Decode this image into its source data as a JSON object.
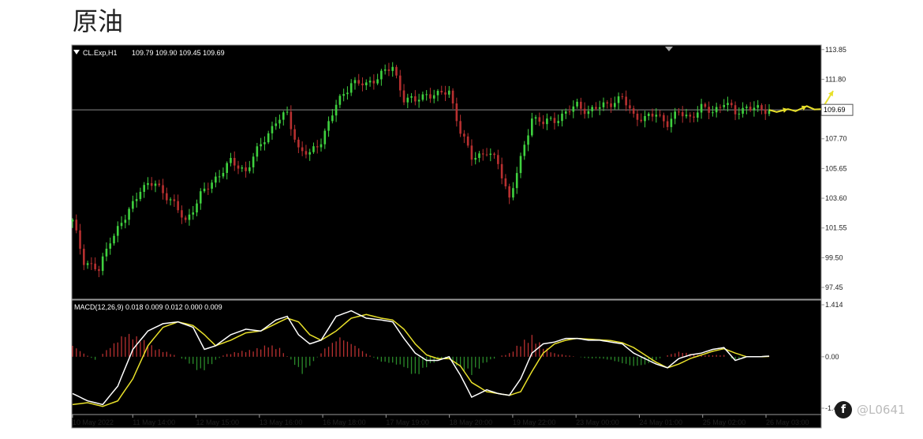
{
  "header": {
    "title": "原油"
  },
  "watermark": {
    "icon": "facebook-icon",
    "text": "@L0641"
  },
  "chart_data": [
    {
      "type": "candlestick",
      "symbol_label": "CL.Exp,H1",
      "ohlc_label": "109.79 109.90 109.45 109.69",
      "current_price_label": "109.69",
      "ylim": [
        96.8,
        114.0
      ],
      "yticks": [
        "113.85",
        "111.80",
        "109.69",
        "107.70",
        "105.65",
        "103.60",
        "101.55",
        "99.50",
        "97.45"
      ],
      "xtick_labels": [
        "10 May 2022",
        "11 May 14:00",
        "12 May 15:00",
        "13 May 16:00",
        "16 May 18:00",
        "17 May 19:00",
        "18 May 20:00",
        "19 May 22:00",
        "23 May 00:00",
        "24 May 01:00",
        "25 May 02:00",
        "26 May 03:00"
      ],
      "up_color": "#3fd13f",
      "down_color": "#b83030",
      "background": "#000000",
      "current_price": 109.69,
      "close_path": [
        {
          "i": 0,
          "v": 102.0
        },
        {
          "i": 3,
          "v": 99.3
        },
        {
          "i": 7,
          "v": 98.6
        },
        {
          "i": 10,
          "v": 100.8
        },
        {
          "i": 14,
          "v": 102.2
        },
        {
          "i": 18,
          "v": 104.3
        },
        {
          "i": 22,
          "v": 104.6
        },
        {
          "i": 26,
          "v": 103.5
        },
        {
          "i": 30,
          "v": 102.0
        },
        {
          "i": 34,
          "v": 103.8
        },
        {
          "i": 38,
          "v": 105.0
        },
        {
          "i": 42,
          "v": 106.1
        },
        {
          "i": 46,
          "v": 105.5
        },
        {
          "i": 50,
          "v": 107.3
        },
        {
          "i": 54,
          "v": 108.9
        },
        {
          "i": 57,
          "v": 109.4
        },
        {
          "i": 60,
          "v": 107.0
        },
        {
          "i": 63,
          "v": 106.6
        },
        {
          "i": 66,
          "v": 107.6
        },
        {
          "i": 70,
          "v": 110.0
        },
        {
          "i": 74,
          "v": 111.6
        },
        {
          "i": 78,
          "v": 111.4
        },
        {
          "i": 82,
          "v": 112.2
        },
        {
          "i": 85,
          "v": 112.6
        },
        {
          "i": 88,
          "v": 110.5
        },
        {
          "i": 91,
          "v": 110.3
        },
        {
          "i": 94,
          "v": 110.8
        },
        {
          "i": 97,
          "v": 110.7
        },
        {
          "i": 100,
          "v": 111.0
        },
        {
          "i": 103,
          "v": 108.2
        },
        {
          "i": 106,
          "v": 106.4
        },
        {
          "i": 110,
          "v": 106.8
        },
        {
          "i": 113,
          "v": 106.0
        },
        {
          "i": 116,
          "v": 103.6
        },
        {
          "i": 119,
          "v": 106.2
        },
        {
          "i": 122,
          "v": 109.2
        },
        {
          "i": 125,
          "v": 108.8
        },
        {
          "i": 128,
          "v": 109.0
        },
        {
          "i": 131,
          "v": 109.5
        },
        {
          "i": 134,
          "v": 110.0
        },
        {
          "i": 137,
          "v": 109.6
        },
        {
          "i": 140,
          "v": 109.9
        },
        {
          "i": 143,
          "v": 110.2
        },
        {
          "i": 146,
          "v": 110.5
        },
        {
          "i": 149,
          "v": 109.3
        },
        {
          "i": 152,
          "v": 109.1
        },
        {
          "i": 155,
          "v": 109.4
        },
        {
          "i": 158,
          "v": 108.8
        },
        {
          "i": 161,
          "v": 109.5
        },
        {
          "i": 164,
          "v": 109.2
        },
        {
          "i": 167,
          "v": 109.8
        },
        {
          "i": 170,
          "v": 109.6
        },
        {
          "i": 173,
          "v": 110.2
        },
        {
          "i": 176,
          "v": 109.5
        },
        {
          "i": 179,
          "v": 109.9
        },
        {
          "i": 182,
          "v": 109.7
        },
        {
          "i": 185,
          "v": 109.69
        }
      ],
      "candle_count": 186,
      "forecast_path": [
        {
          "i": 185,
          "v": 109.69
        },
        {
          "i": 187,
          "v": 109.55
        },
        {
          "i": 190,
          "v": 109.75
        },
        {
          "i": 192,
          "v": 109.6
        },
        {
          "i": 195,
          "v": 109.95
        },
        {
          "i": 197,
          "v": 109.72
        },
        {
          "i": 199,
          "v": 109.75
        },
        {
          "i": 202,
          "v": 111.0
        }
      ],
      "forecast_color": "#e8e02a"
    },
    {
      "type": "macd",
      "label": "MACD(12,26,9) 0.018 0.009 0.012 0.000 0.009",
      "ylim": [
        -1.55,
        1.5
      ],
      "yticks": [
        "1.414",
        "0.00",
        "-1.4"
      ],
      "macd_line": [
        {
          "i": 0,
          "v": -1.0
        },
        {
          "i": 4,
          "v": -1.2
        },
        {
          "i": 8,
          "v": -1.3
        },
        {
          "i": 12,
          "v": -0.8
        },
        {
          "i": 16,
          "v": 0.2
        },
        {
          "i": 20,
          "v": 0.7
        },
        {
          "i": 24,
          "v": 0.9
        },
        {
          "i": 28,
          "v": 0.95
        },
        {
          "i": 32,
          "v": 0.8
        },
        {
          "i": 35,
          "v": 0.2
        },
        {
          "i": 38,
          "v": 0.3
        },
        {
          "i": 42,
          "v": 0.6
        },
        {
          "i": 46,
          "v": 0.75
        },
        {
          "i": 50,
          "v": 0.7
        },
        {
          "i": 54,
          "v": 1.0
        },
        {
          "i": 57,
          "v": 1.1
        },
        {
          "i": 60,
          "v": 0.6
        },
        {
          "i": 63,
          "v": 0.35
        },
        {
          "i": 66,
          "v": 0.45
        },
        {
          "i": 70,
          "v": 1.1
        },
        {
          "i": 74,
          "v": 1.25
        },
        {
          "i": 78,
          "v": 1.05
        },
        {
          "i": 82,
          "v": 1.0
        },
        {
          "i": 85,
          "v": 0.95
        },
        {
          "i": 88,
          "v": 0.5
        },
        {
          "i": 91,
          "v": 0.1
        },
        {
          "i": 94,
          "v": -0.1
        },
        {
          "i": 97,
          "v": -0.1
        },
        {
          "i": 100,
          "v": 0.0
        },
        {
          "i": 103,
          "v": -0.5
        },
        {
          "i": 106,
          "v": -1.1
        },
        {
          "i": 110,
          "v": -0.9
        },
        {
          "i": 113,
          "v": -1.0
        },
        {
          "i": 116,
          "v": -1.05
        },
        {
          "i": 119,
          "v": -0.6
        },
        {
          "i": 122,
          "v": 0.1
        },
        {
          "i": 125,
          "v": 0.35
        },
        {
          "i": 128,
          "v": 0.4
        },
        {
          "i": 131,
          "v": 0.5
        },
        {
          "i": 134,
          "v": 0.5
        },
        {
          "i": 137,
          "v": 0.45
        },
        {
          "i": 140,
          "v": 0.45
        },
        {
          "i": 143,
          "v": 0.4
        },
        {
          "i": 146,
          "v": 0.35
        },
        {
          "i": 149,
          "v": 0.1
        },
        {
          "i": 152,
          "v": -0.05
        },
        {
          "i": 155,
          "v": -0.2
        },
        {
          "i": 158,
          "v": -0.3
        },
        {
          "i": 161,
          "v": -0.05
        },
        {
          "i": 164,
          "v": 0.05
        },
        {
          "i": 167,
          "v": 0.1
        },
        {
          "i": 170,
          "v": 0.2
        },
        {
          "i": 173,
          "v": 0.25
        },
        {
          "i": 176,
          "v": -0.1
        },
        {
          "i": 179,
          "v": 0.0
        },
        {
          "i": 182,
          "v": 0.0
        },
        {
          "i": 185,
          "v": 0.018
        }
      ],
      "signal_line": [
        {
          "i": 0,
          "v": -1.3
        },
        {
          "i": 4,
          "v": -1.25
        },
        {
          "i": 8,
          "v": -1.35
        },
        {
          "i": 12,
          "v": -1.2
        },
        {
          "i": 16,
          "v": -0.6
        },
        {
          "i": 20,
          "v": 0.3
        },
        {
          "i": 24,
          "v": 0.8
        },
        {
          "i": 28,
          "v": 0.95
        },
        {
          "i": 32,
          "v": 0.85
        },
        {
          "i": 35,
          "v": 0.6
        },
        {
          "i": 38,
          "v": 0.3
        },
        {
          "i": 42,
          "v": 0.45
        },
        {
          "i": 46,
          "v": 0.65
        },
        {
          "i": 50,
          "v": 0.7
        },
        {
          "i": 54,
          "v": 0.9
        },
        {
          "i": 57,
          "v": 1.05
        },
        {
          "i": 60,
          "v": 0.95
        },
        {
          "i": 63,
          "v": 0.6
        },
        {
          "i": 66,
          "v": 0.45
        },
        {
          "i": 70,
          "v": 0.7
        },
        {
          "i": 74,
          "v": 1.05
        },
        {
          "i": 78,
          "v": 1.15
        },
        {
          "i": 82,
          "v": 1.05
        },
        {
          "i": 85,
          "v": 1.0
        },
        {
          "i": 88,
          "v": 0.75
        },
        {
          "i": 91,
          "v": 0.35
        },
        {
          "i": 94,
          "v": 0.05
        },
        {
          "i": 97,
          "v": -0.05
        },
        {
          "i": 100,
          "v": -0.05
        },
        {
          "i": 103,
          "v": -0.25
        },
        {
          "i": 106,
          "v": -0.7
        },
        {
          "i": 110,
          "v": -0.95
        },
        {
          "i": 113,
          "v": -1.0
        },
        {
          "i": 116,
          "v": -1.05
        },
        {
          "i": 119,
          "v": -0.95
        },
        {
          "i": 122,
          "v": -0.4
        },
        {
          "i": 125,
          "v": 0.1
        },
        {
          "i": 128,
          "v": 0.35
        },
        {
          "i": 131,
          "v": 0.45
        },
        {
          "i": 134,
          "v": 0.5
        },
        {
          "i": 137,
          "v": 0.48
        },
        {
          "i": 140,
          "v": 0.46
        },
        {
          "i": 143,
          "v": 0.44
        },
        {
          "i": 146,
          "v": 0.38
        },
        {
          "i": 149,
          "v": 0.25
        },
        {
          "i": 152,
          "v": 0.05
        },
        {
          "i": 155,
          "v": -0.15
        },
        {
          "i": 158,
          "v": -0.3
        },
        {
          "i": 161,
          "v": -0.2
        },
        {
          "i": 164,
          "v": -0.05
        },
        {
          "i": 167,
          "v": 0.05
        },
        {
          "i": 170,
          "v": 0.15
        },
        {
          "i": 173,
          "v": 0.22
        },
        {
          "i": 176,
          "v": 0.1
        },
        {
          "i": 179,
          "v": 0.0
        },
        {
          "i": 182,
          "v": 0.0
        },
        {
          "i": 185,
          "v": 0.009
        }
      ],
      "histogram": [
        {
          "i": 0,
          "v": 0.35
        },
        {
          "i": 3,
          "v": 0.1
        },
        {
          "i": 6,
          "v": -0.1
        },
        {
          "i": 10,
          "v": 0.3
        },
        {
          "i": 14,
          "v": 0.7
        },
        {
          "i": 18,
          "v": 0.55
        },
        {
          "i": 22,
          "v": 0.25
        },
        {
          "i": 26,
          "v": 0.1
        },
        {
          "i": 30,
          "v": -0.1
        },
        {
          "i": 34,
          "v": -0.45
        },
        {
          "i": 37,
          "v": -0.2
        },
        {
          "i": 40,
          "v": 0.05
        },
        {
          "i": 44,
          "v": 0.15
        },
        {
          "i": 48,
          "v": 0.2
        },
        {
          "i": 52,
          "v": 0.35
        },
        {
          "i": 55,
          "v": 0.25
        },
        {
          "i": 58,
          "v": -0.1
        },
        {
          "i": 61,
          "v": -0.5
        },
        {
          "i": 64,
          "v": -0.15
        },
        {
          "i": 67,
          "v": 0.25
        },
        {
          "i": 71,
          "v": 0.6
        },
        {
          "i": 75,
          "v": 0.35
        },
        {
          "i": 78,
          "v": 0.1
        },
        {
          "i": 82,
          "v": -0.15
        },
        {
          "i": 85,
          "v": -0.2
        },
        {
          "i": 88,
          "v": -0.3
        },
        {
          "i": 91,
          "v": -0.6
        },
        {
          "i": 94,
          "v": -0.3
        },
        {
          "i": 97,
          "v": -0.1
        },
        {
          "i": 100,
          "v": -0.05
        },
        {
          "i": 103,
          "v": -0.35
        },
        {
          "i": 106,
          "v": -0.5
        },
        {
          "i": 110,
          "v": -0.15
        },
        {
          "i": 113,
          "v": 0.0
        },
        {
          "i": 116,
          "v": 0.1
        },
        {
          "i": 119,
          "v": 0.4
        },
        {
          "i": 122,
          "v": 0.6
        },
        {
          "i": 125,
          "v": 0.3
        },
        {
          "i": 128,
          "v": 0.1
        },
        {
          "i": 131,
          "v": 0.05
        },
        {
          "i": 134,
          "v": 0.0
        },
        {
          "i": 137,
          "v": -0.05
        },
        {
          "i": 140,
          "v": -0.05
        },
        {
          "i": 143,
          "v": -0.1
        },
        {
          "i": 146,
          "v": -0.2
        },
        {
          "i": 149,
          "v": -0.3
        },
        {
          "i": 152,
          "v": -0.25
        },
        {
          "i": 155,
          "v": -0.1
        },
        {
          "i": 158,
          "v": 0.05
        },
        {
          "i": 161,
          "v": 0.15
        },
        {
          "i": 164,
          "v": 0.1
        },
        {
          "i": 167,
          "v": 0.05
        },
        {
          "i": 170,
          "v": 0.05
        },
        {
          "i": 173,
          "v": 0.05
        },
        {
          "i": 176,
          "v": -0.1
        },
        {
          "i": 179,
          "v": 0.0
        },
        {
          "i": 182,
          "v": 0.0
        },
        {
          "i": 185,
          "v": 0.009
        }
      ],
      "macd_color": "#ffffff",
      "signal_color": "#e8e02a",
      "hist_up_color": "#b83030",
      "hist_down_color": "#2a8a2a"
    }
  ]
}
